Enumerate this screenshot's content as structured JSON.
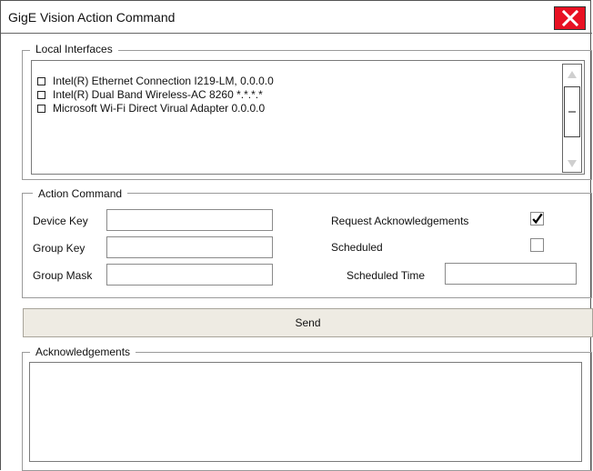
{
  "window": {
    "title": "GigE Vision Action Command"
  },
  "local_interfaces": {
    "legend": "Local Interfaces",
    "items": [
      {
        "label": "Intel(R) Ethernet Connection I219-LM, 0.0.0.0",
        "checked": false
      },
      {
        "label": "Intel(R) Dual Band Wireless-AC 8260 *.*.*.*",
        "checked": false
      },
      {
        "label": "Microsoft Wi-Fi Direct Virual Adapter 0.0.0.0",
        "checked": false
      }
    ]
  },
  "action_command": {
    "legend": "Action Command",
    "device_key_label": "Device Key",
    "device_key_value": "",
    "group_key_label": "Group Key",
    "group_key_value": "",
    "group_mask_label": "Group Mask",
    "group_mask_value": "",
    "request_ack_label": "Request Acknowledgements",
    "request_ack_checked": true,
    "scheduled_label": "Scheduled",
    "scheduled_checked": false,
    "scheduled_time_label": "Scheduled Time",
    "scheduled_time_value": ""
  },
  "send_button": {
    "label": "Send"
  },
  "acknowledgements": {
    "legend": "Acknowledgements"
  },
  "colors": {
    "close_button": "#e81123",
    "send_button_bg": "#eeebe3"
  }
}
